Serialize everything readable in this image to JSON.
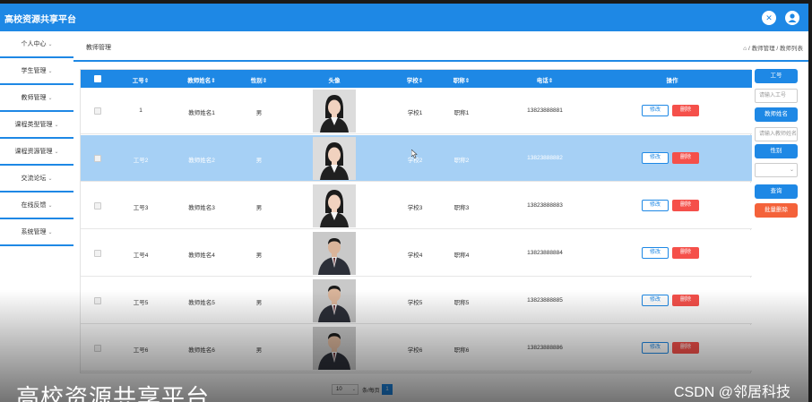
{
  "app": {
    "title": "高校资源共享平台"
  },
  "sidebar": {
    "items": [
      {
        "label": "个人中心"
      },
      {
        "label": "学生管理"
      },
      {
        "label": "教师管理"
      },
      {
        "label": "课程类型管理"
      },
      {
        "label": "课程资源管理"
      },
      {
        "label": "交流论坛"
      },
      {
        "label": "在线反馈"
      },
      {
        "label": "系统管理"
      }
    ],
    "caret": "⌄"
  },
  "breadcrumb": {
    "title": "教师管理",
    "home_icon": "home-icon",
    "path": "/ 教师管理 / 教师列表"
  },
  "table": {
    "headers": {
      "id": "工号",
      "name": "教师姓名",
      "gender": "性别",
      "avatar": "头像",
      "school": "学校",
      "title": "职称",
      "phone": "电话",
      "action": "操作"
    },
    "rows": [
      {
        "id": "1",
        "name": "教师姓名1",
        "gender": "男",
        "school": "学校1",
        "title": "职称1",
        "phone": "13823888881",
        "edit": "修改",
        "del": "删除",
        "avatar": "female"
      },
      {
        "id": "工号2",
        "name": "教师姓名2",
        "gender": "男",
        "school": "学校2",
        "title": "职称2",
        "phone": "13823888882",
        "edit": "修改",
        "del": "删除",
        "avatar": "female"
      },
      {
        "id": "工号3",
        "name": "教师姓名3",
        "gender": "男",
        "school": "学校3",
        "title": "职称3",
        "phone": "13823888883",
        "edit": "修改",
        "del": "删除",
        "avatar": "female"
      },
      {
        "id": "工号4",
        "name": "教师姓名4",
        "gender": "男",
        "school": "学校4",
        "title": "职称4",
        "phone": "13823888884",
        "edit": "修改",
        "del": "删除",
        "avatar": "male"
      },
      {
        "id": "工号5",
        "name": "教师姓名5",
        "gender": "男",
        "school": "学校5",
        "title": "职称5",
        "phone": "13823888885",
        "edit": "修改",
        "del": "删除",
        "avatar": "male"
      },
      {
        "id": "工号6",
        "name": "教师姓名6",
        "gender": "男",
        "school": "学校6",
        "title": "职称6",
        "phone": "13823888886",
        "edit": "修改",
        "del": "删除",
        "avatar": "male"
      }
    ]
  },
  "filters": {
    "id_label": "工号",
    "id_placeholder": "请输入工号",
    "name_label": "教师姓名",
    "name_placeholder": "请输入教师姓名",
    "gender_label": "性别",
    "search_label": "查询",
    "batch_delete_label": "批量删除"
  },
  "pager": {
    "page_size": "10",
    "text": "条/每页",
    "current": "1"
  },
  "overlay": {
    "title": "高校资源共享平台",
    "watermark": "CSDN @邻居科技"
  },
  "colors": {
    "primary": "#1e88e5",
    "danger": "#f5504a",
    "selected_row": "#a6d0f5"
  }
}
